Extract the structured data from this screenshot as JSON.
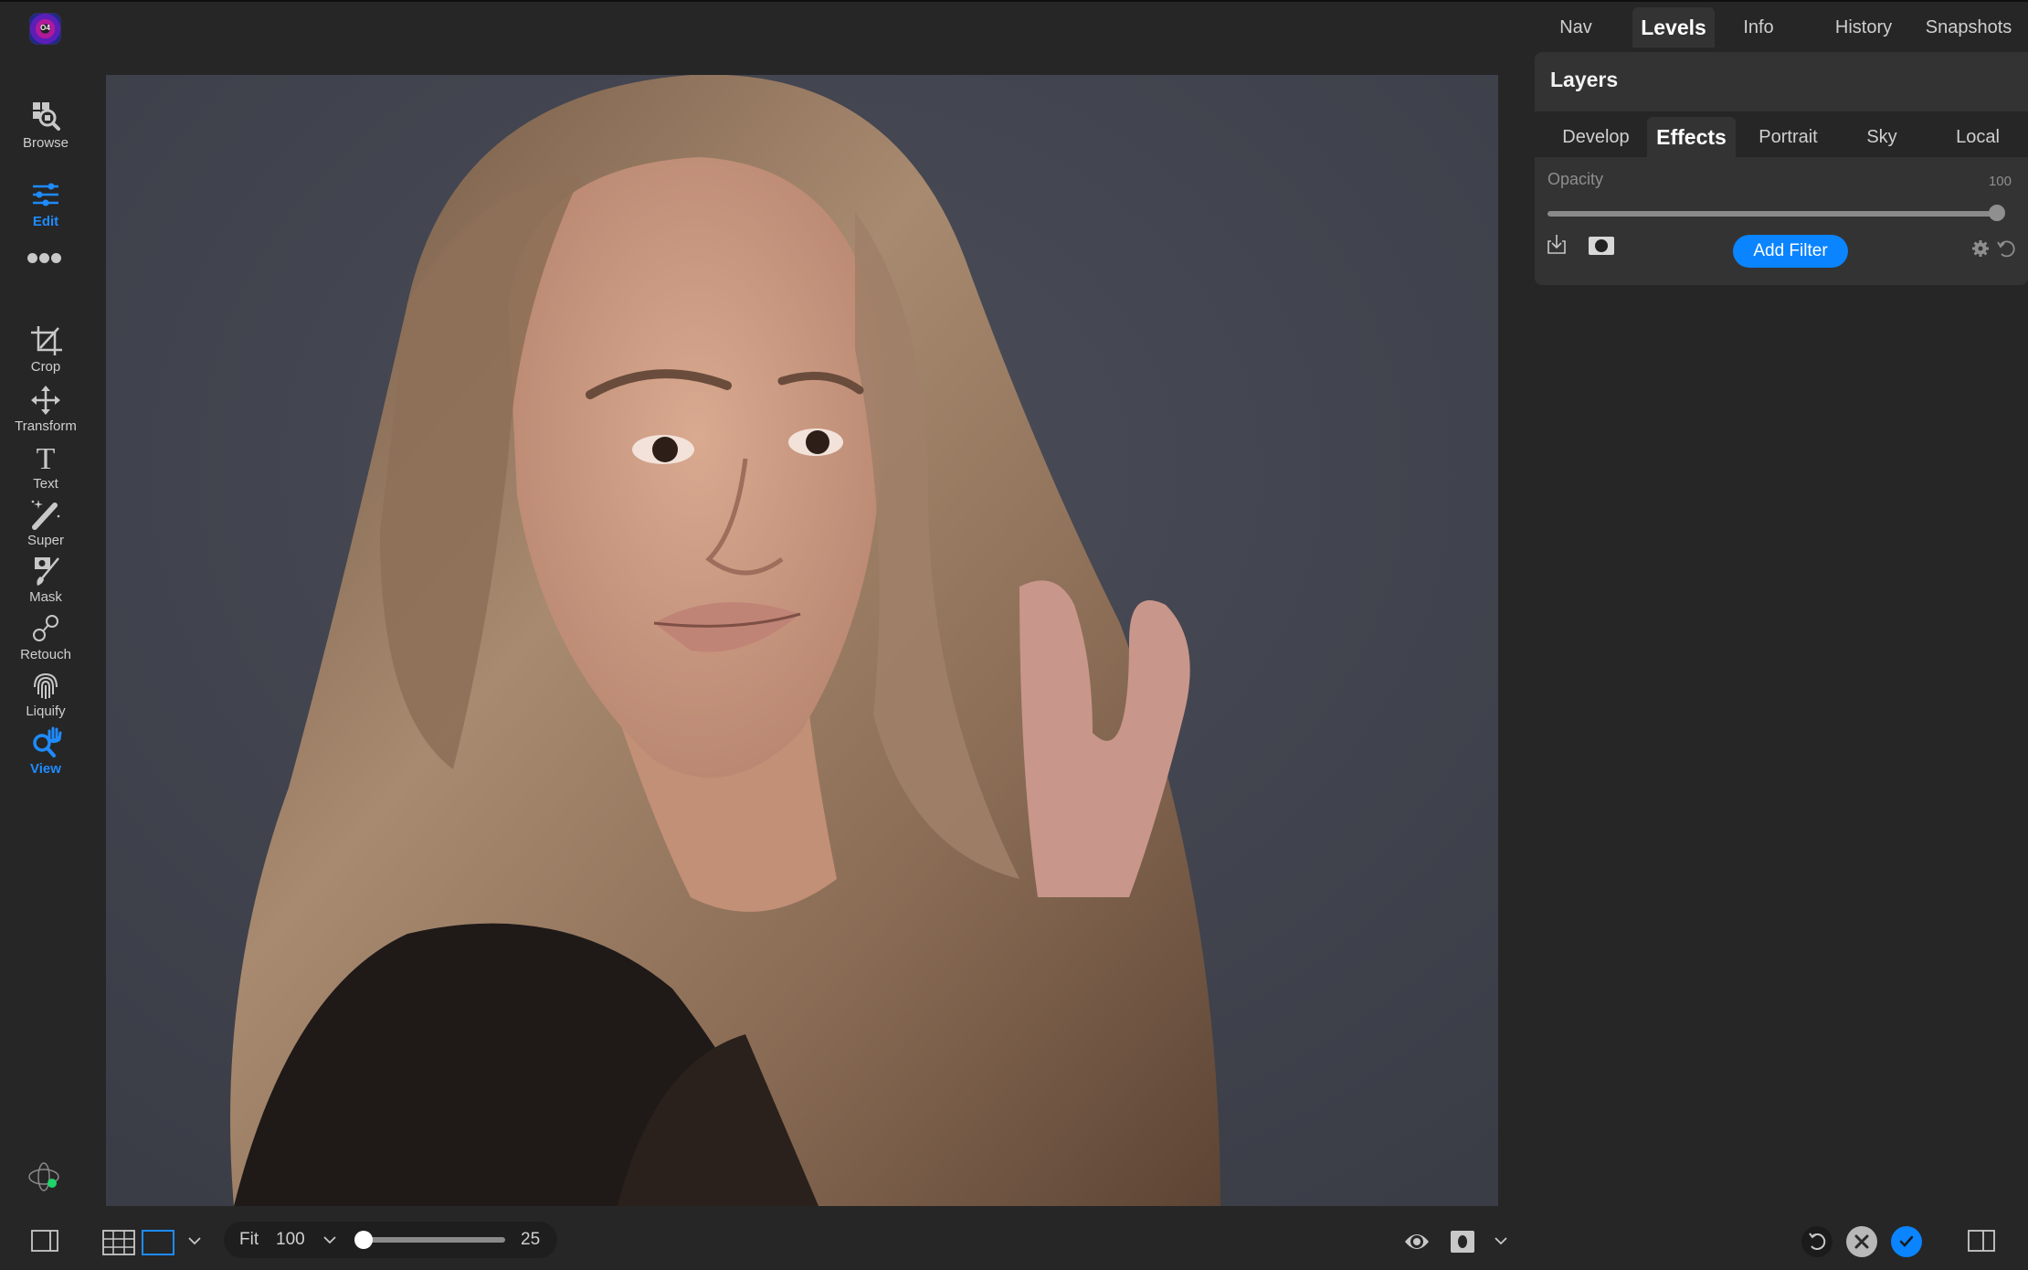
{
  "app": {
    "logo_text": "O4"
  },
  "sidebar": {
    "items": [
      {
        "label": "Browse",
        "icon": "browse-icon",
        "active": false
      },
      {
        "label": "Edit",
        "icon": "sliders-icon",
        "active": true
      },
      {
        "label": "Crop",
        "icon": "crop-icon",
        "active": false
      },
      {
        "label": "Transform",
        "icon": "move-arrows-icon",
        "active": false
      },
      {
        "label": "Text",
        "icon": "text-icon",
        "active": false
      },
      {
        "label": "Super",
        "icon": "magic-wand-icon",
        "active": false
      },
      {
        "label": "Mask",
        "icon": "mask-brush-icon",
        "active": false
      },
      {
        "label": "Retouch",
        "icon": "retouch-circles-icon",
        "active": false
      },
      {
        "label": "Liquify",
        "icon": "fingerprint-icon",
        "active": false
      },
      {
        "label": "View",
        "icon": "zoom-hand-icon",
        "active": true
      }
    ],
    "more_icon": "more-dots-icon",
    "bottom_icon": "orbit-status-icon"
  },
  "canvas": {
    "image_description": "Portrait of a woman with long wavy light-brown hair against a grey studio backdrop",
    "background_color": "#3e404a"
  },
  "right_panel": {
    "top_tabs": [
      {
        "label": "Nav",
        "active": false
      },
      {
        "label": "Levels",
        "active": true
      },
      {
        "label": "Info",
        "active": false
      },
      {
        "label": "History",
        "active": false
      },
      {
        "label": "Snapshots",
        "active": false
      }
    ],
    "layers_title": "Layers",
    "sub_tabs": [
      {
        "label": "Develop",
        "active": false
      },
      {
        "label": "Effects",
        "active": true
      },
      {
        "label": "Portrait",
        "active": false
      },
      {
        "label": "Sky",
        "active": false
      },
      {
        "label": "Local",
        "active": false
      }
    ],
    "opacity": {
      "label": "Opacity",
      "value": "100",
      "fraction": 1.0
    },
    "add_filter_label": "Add Filter",
    "accent_color": "#0a84ff"
  },
  "bottom_bar": {
    "zoom_fit_label": "Fit",
    "zoom_value": "100",
    "slider_value": "25",
    "slider_fraction": 0.0
  }
}
